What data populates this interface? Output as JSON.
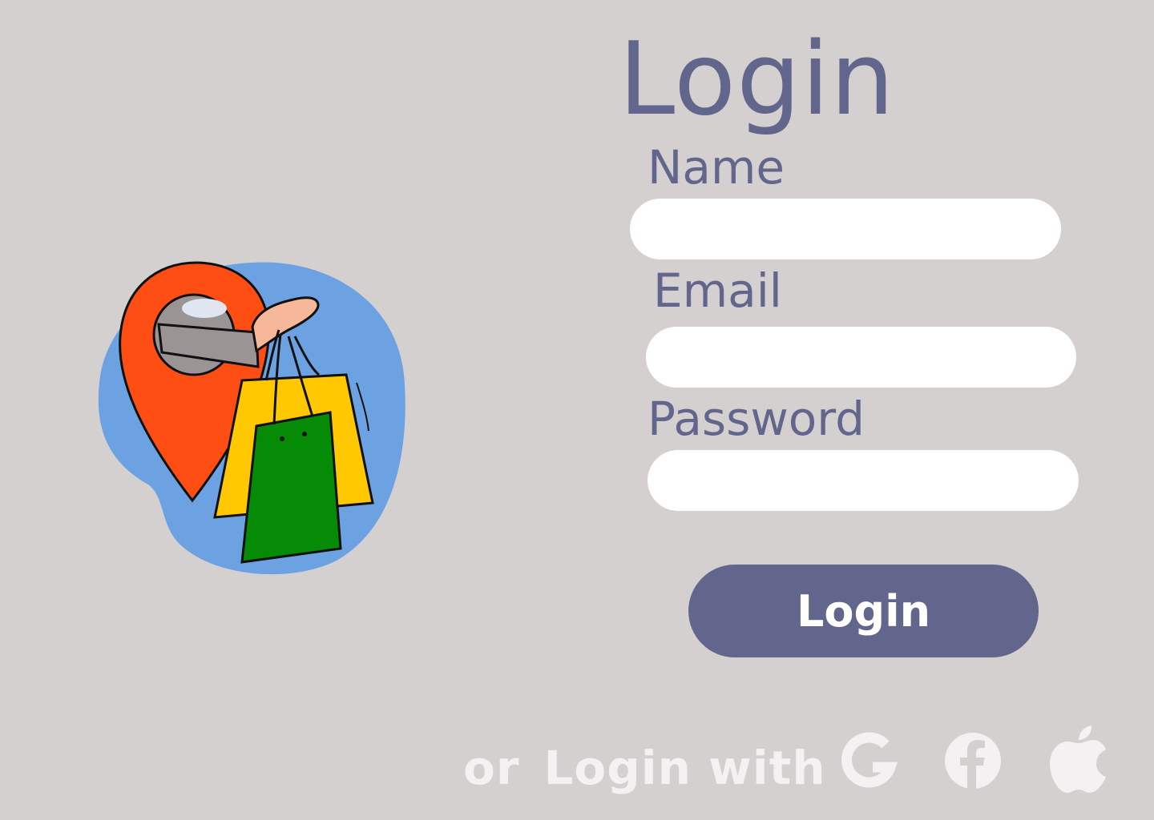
{
  "page": {
    "title": "Login"
  },
  "form": {
    "name_label": "Name",
    "name_value": "",
    "email_label": "Email",
    "email_value": "",
    "password_label": "Password",
    "password_value": "",
    "submit_label": "Login"
  },
  "alternate": {
    "or_label": "or",
    "login_with_label": "Login with",
    "providers": [
      {
        "name": "Google",
        "icon": "google-icon"
      },
      {
        "name": "Facebook",
        "icon": "facebook-icon"
      },
      {
        "name": "Apple",
        "icon": "apple-icon"
      }
    ]
  },
  "illustration": {
    "icon": "location-pin-shopping-bags-icon"
  },
  "colors": {
    "background": "#d3d0cf",
    "accent": "#62668c",
    "input": "#ffffff",
    "muted_text": "#f3f1f1",
    "blob": "#6ca1e2",
    "pin": "#fe4e14",
    "bag_yellow": "#ffc800",
    "bag_green": "#058b05"
  }
}
